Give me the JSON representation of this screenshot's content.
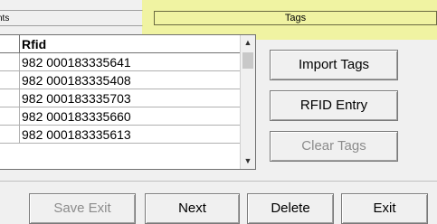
{
  "header": {
    "left_title": "nts",
    "tags_title": "Tags",
    "highlight_color": "#f0f562"
  },
  "grid": {
    "column_header": "Rfid",
    "rows": [
      "982 000183335641",
      "982 000183335408",
      "982 000183335703",
      "982 000183335660",
      "982 000183335613"
    ],
    "scroll_up_icon": "arrow-up-icon",
    "scroll_down_icon": "arrow-down-icon"
  },
  "buttons": {
    "import_tags": "Import Tags",
    "rfid_entry": "RFID Entry",
    "clear_tags": "Clear Tags",
    "save_exit": "Save  Exit",
    "next": "Next",
    "delete": "Delete",
    "exit": "Exit"
  }
}
